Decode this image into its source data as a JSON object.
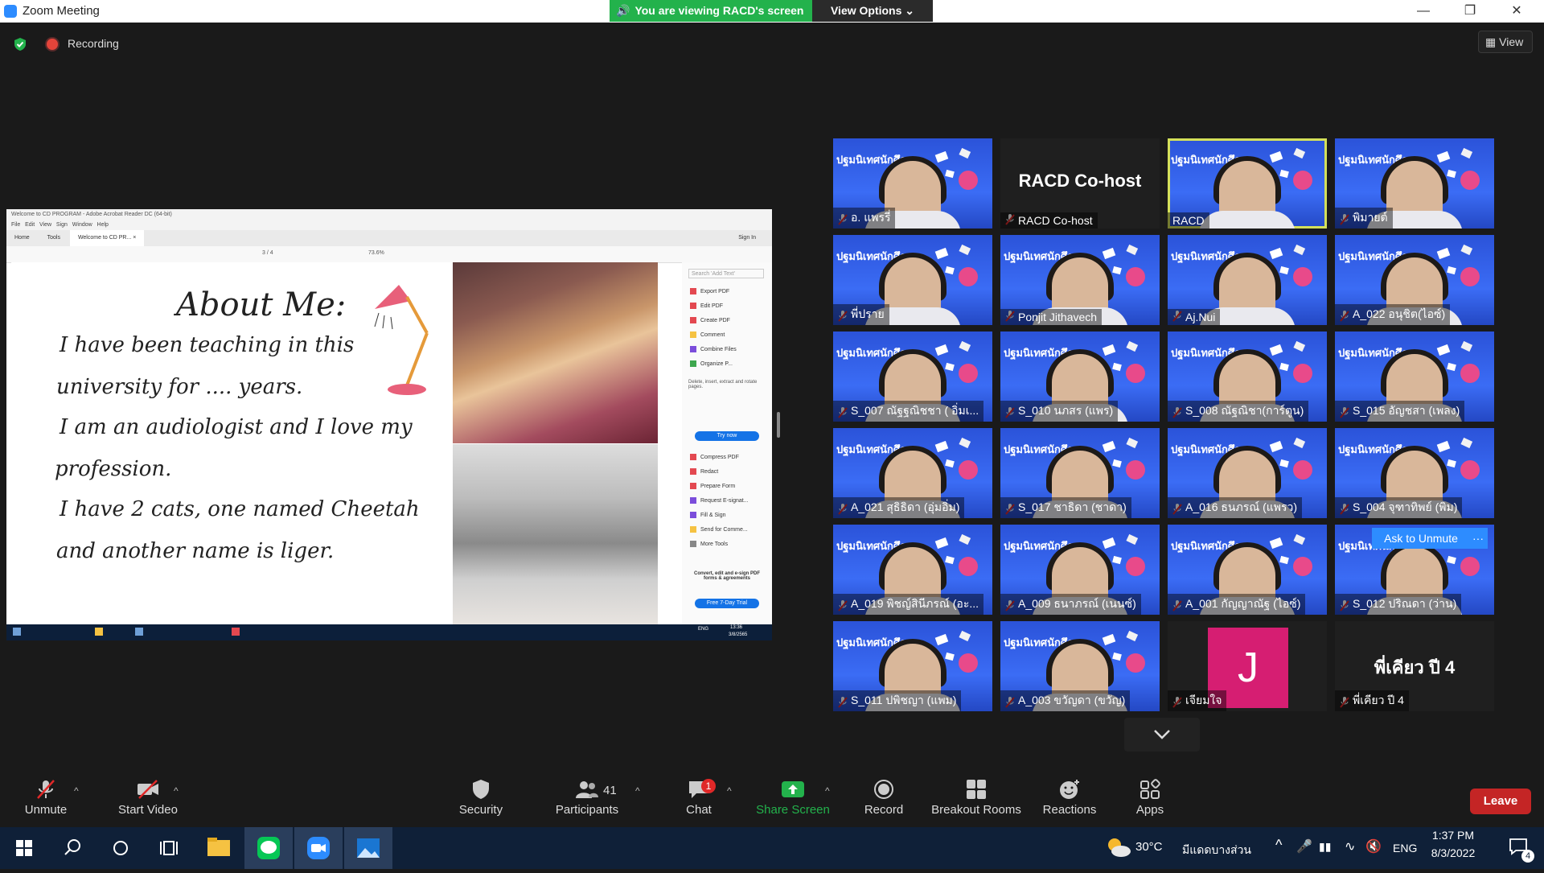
{
  "window": {
    "title": "Zoom Meeting"
  },
  "banner": {
    "viewing_text": "You are viewing RACD's screen",
    "view_options": "View Options"
  },
  "status": {
    "recording_label": "Recording",
    "view_label": "View"
  },
  "shared_screen": {
    "acrobat_title": "Welcome to CD PROGRAM - Adobe Acrobat Reader DC (64-bit)",
    "menu": [
      "File",
      "Edit",
      "View",
      "Sign",
      "Window",
      "Help"
    ],
    "tabs": [
      "Home",
      "Tools",
      "Welcome to CD PR... ×"
    ],
    "sign_in": "Sign In",
    "page_indicator": "3 / 4",
    "zoom": "73.6%",
    "doc_heading": "About Me:",
    "doc_lines": [
      "I have been teaching in this",
      "university for .... years.",
      "I am an audiologist and I love my",
      "profession.",
      "I have 2 cats, one named Cheetah",
      "and another name is liger."
    ],
    "panel": {
      "search_placeholder": "Search 'Add Text'",
      "tools": [
        "Export PDF",
        "Edit PDF",
        "Create PDF",
        "Comment",
        "Combine Files",
        "Organize P...",
        "Compress PDF",
        "Redact",
        "Prepare Form",
        "Request E-signat...",
        "Fill & Sign",
        "Send for Comme...",
        "More Tools"
      ],
      "organize_desc": "Delete, insert, extract and rotate pages.",
      "try_now": "Try now",
      "promo": "Convert, edit and e-sign PDF forms & agreements",
      "free_trial": "Free 7-Day Trial"
    },
    "taskbar_time": "13:36",
    "taskbar_date": "3/8/2565",
    "taskbar_lang": "ENG"
  },
  "gallery": {
    "tiles": [
      {
        "name": "อ. แพรรี่",
        "kind": "video"
      },
      {
        "name": "RACD Co-host",
        "kind": "text",
        "big": "RACD Co-host"
      },
      {
        "name": "RACD",
        "kind": "video",
        "active": true
      },
      {
        "name": "พิมายต์",
        "kind": "video"
      },
      {
        "name": "พี่ปราย",
        "kind": "video"
      },
      {
        "name": "Ponjit Jithavech",
        "kind": "video"
      },
      {
        "name": "Aj.Nui",
        "kind": "video"
      },
      {
        "name": "A_022 อนุชิต(ไอซ์)",
        "kind": "video"
      },
      {
        "name": "S_007 ณัฐฐณิชชา ( อิ่มเ...",
        "kind": "video"
      },
      {
        "name": "S_010 นภสร (แพร)",
        "kind": "video"
      },
      {
        "name": "S_008 ณัฐณิชา(การ์ตูน)",
        "kind": "video"
      },
      {
        "name": "S_015 อัญชสา (เพลง)",
        "kind": "video"
      },
      {
        "name": "A_021 สุธิธิดา (อุ่มอิ่ม)",
        "kind": "video"
      },
      {
        "name": "S_017 ชาธิดา (ชาดา)",
        "kind": "video"
      },
      {
        "name": "A_016 ธนภรณ์ (แพรว)",
        "kind": "video"
      },
      {
        "name": "S_004 จุฑาทิพย์ (พิม)",
        "kind": "video"
      },
      {
        "name": "A_019 พิชญ์สินีภรณ์ (อะ...",
        "kind": "video"
      },
      {
        "name": "A_009 ธนาภรณ์ (เนนซ์)",
        "kind": "video"
      },
      {
        "name": "A_001 กัญญาณัฐ (ไอซ์)",
        "kind": "video"
      },
      {
        "name": "S_012 ปริณดา (ว่าน)",
        "kind": "video"
      },
      {
        "name": "S_011 ปพิชญา (แพม)",
        "kind": "video"
      },
      {
        "name": "A_003 ขวัญดา (ขวัญ)",
        "kind": "video"
      },
      {
        "name": "เจียมใจ",
        "kind": "avatar",
        "initial": "J"
      },
      {
        "name": "พี่เคียว ปี 4",
        "kind": "text",
        "big": "พี่เคียว ปี 4"
      }
    ],
    "video_banner": "ปฐมนิเทศนักศึกษา",
    "ask_to_unmute": "Ask to Unmute",
    "tile_more": "···"
  },
  "toolbar": {
    "unmute": "Unmute",
    "start_video": "Start Video",
    "security": "Security",
    "participants": "Participants",
    "participants_count": "41",
    "chat": "Chat",
    "chat_badge": "1",
    "share_screen": "Share Screen",
    "record": "Record",
    "breakout_rooms": "Breakout Rooms",
    "reactions": "Reactions",
    "apps": "Apps",
    "leave": "Leave"
  },
  "taskbar": {
    "temperature": "30°C",
    "weather": "มีแดดบางส่วน",
    "language": "ENG",
    "time": "1:37 PM",
    "date": "8/3/2022",
    "notifications": "4"
  },
  "colors": {
    "zoom_blue": "#2d8cff",
    "green_banner": "#23b24c",
    "leave_red": "#c42525",
    "share_green": "#23b24c",
    "active_speaker": "#d4e05a"
  }
}
